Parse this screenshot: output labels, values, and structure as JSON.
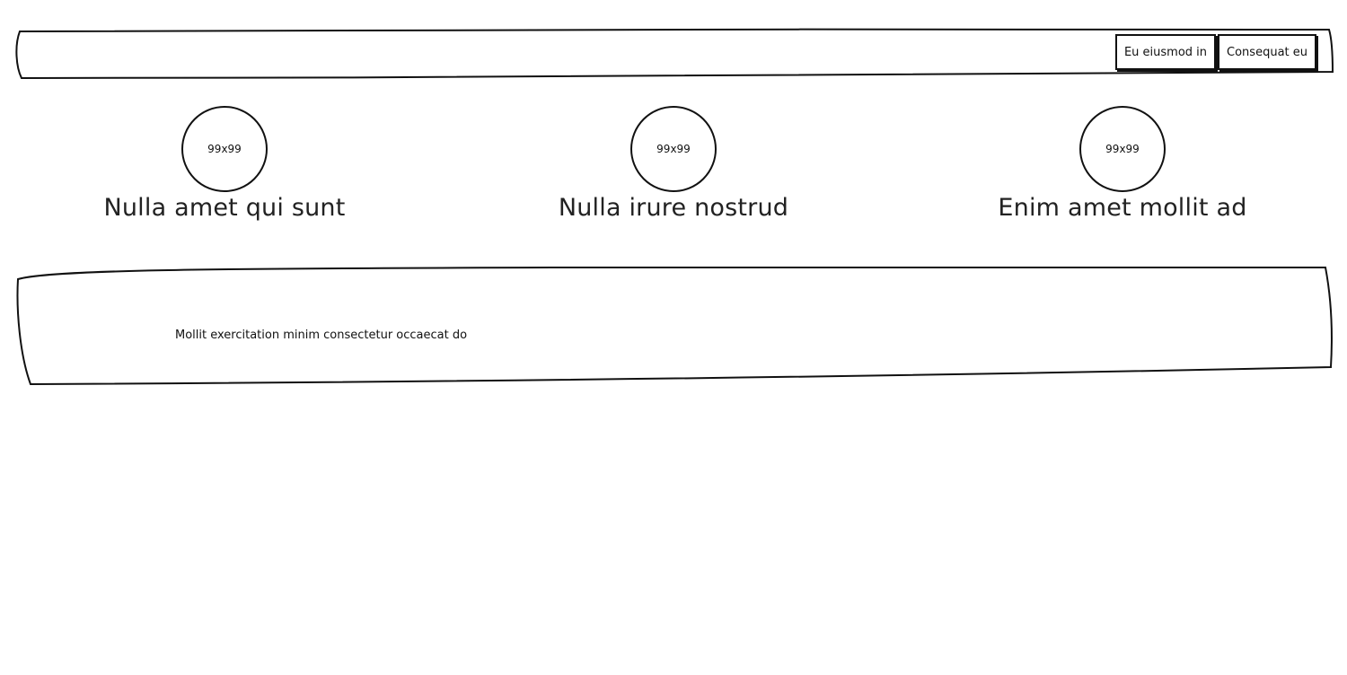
{
  "header": {
    "nav": [
      {
        "label": "Eu eiusmod in"
      },
      {
        "label": "Consequat eu"
      }
    ]
  },
  "features": [
    {
      "image_label": "99x99",
      "title": "Nulla amet qui sunt"
    },
    {
      "image_label": "99x99",
      "title": "Nulla irure nostrud"
    },
    {
      "image_label": "99x99",
      "title": "Enim amet mollit ad"
    }
  ],
  "content": {
    "text": "Mollit exercitation minim consectetur occaecat do"
  }
}
